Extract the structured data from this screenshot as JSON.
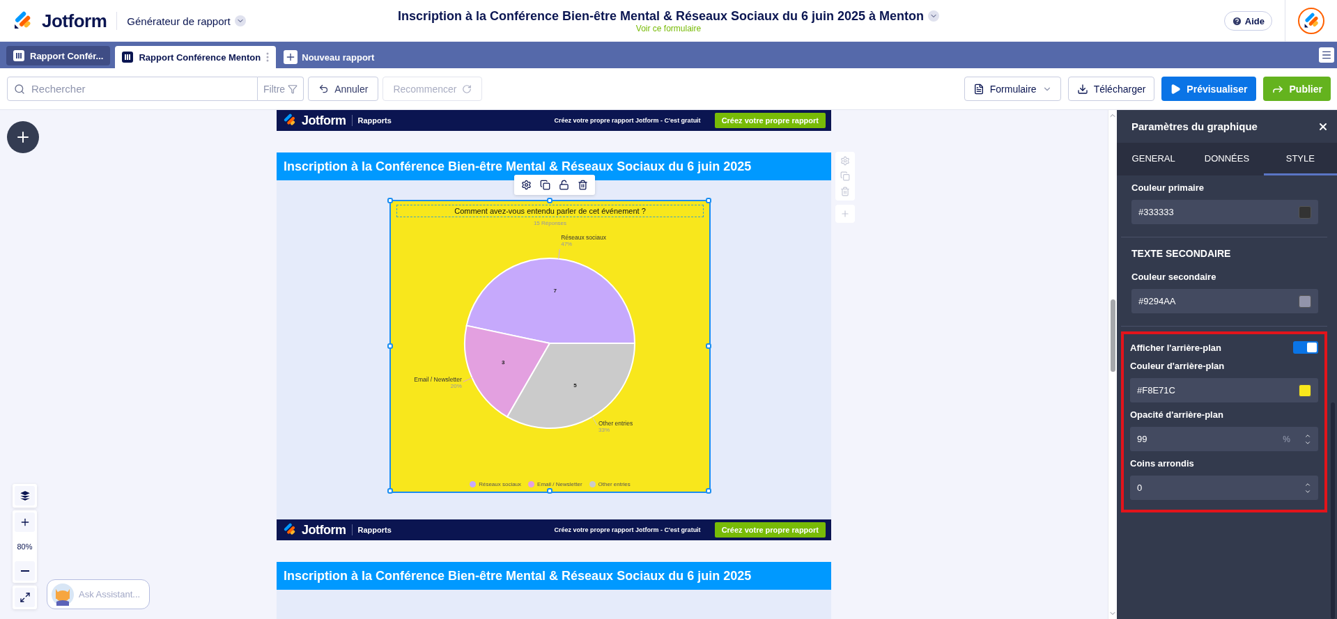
{
  "header": {
    "brand": "Jotform",
    "app_menu": "Générateur de rapport",
    "form_title": "Inscription à la Conférence Bien-être Mental & Réseaux Sociaux du 6 juin 2025 à Menton",
    "form_link": "Voir ce formulaire",
    "help": "Aide"
  },
  "tabs": [
    {
      "label": "Rapport Confér...",
      "selected": false
    },
    {
      "label": "Rapport Conférence Menton",
      "selected": true
    }
  ],
  "new_tab": "Nouveau rapport",
  "toolbar": {
    "search_placeholder": "Rechercher",
    "filter": "Filtre",
    "history": [
      {
        "label": "Annuler",
        "disabled": false
      },
      {
        "label": "Recommencer",
        "disabled": true
      }
    ],
    "actions": [
      {
        "label": "Formulaire",
        "kind": "dropdown"
      },
      {
        "label": "Télécharger",
        "kind": "download"
      },
      {
        "label": "Prévisualiser",
        "kind": "preview"
      },
      {
        "label": "Publier",
        "kind": "publish"
      }
    ]
  },
  "canvas": {
    "zoom": "80%",
    "assistant": "Ask Assistant...",
    "pages": [
      {
        "banner": {
          "brand": "Jotform",
          "section": "Rapports",
          "promo": "Créez votre propre rapport Jotform - C'est gratuit",
          "cta": "Créez votre propre rapport"
        },
        "title": "Inscription à la Conférence Bien-être Mental & Réseaux Sociaux du 6 juin 2025",
        "chart": {
          "selected": true,
          "subtitle": "15 Réponses",
          "percent_labels": [
            "47%",
            "20%",
            "33%"
          ],
          "chart_data": {
            "type": "pie",
            "title": "Comment avez-vous entendu parler de cet événement ?",
            "categories": [
              "Réseaux sociaux",
              "Email / Newsletter",
              "Other entries"
            ],
            "values": [
              7,
              3,
              5
            ],
            "data_labels": true
          },
          "legend": [
            {
              "label": "Réseaux sociaux",
              "color": "#c6a9fc"
            },
            {
              "label": "Email / Newsletter",
              "color": "#e3a0e0"
            },
            {
              "label": "Other entries",
              "color": "#cbcbcb"
            }
          ]
        }
      },
      {
        "banner": {
          "brand": "Jotform",
          "section": "Rapports",
          "promo": "Créez votre propre rapport Jotform - C'est gratuit",
          "cta": "Créez votre propre rapport"
        },
        "title": "Inscription à la Conférence Bien-être Mental & Réseaux Sociaux du 6 juin 2025"
      }
    ]
  },
  "settings": {
    "title": "Paramètres du graphique",
    "tabs": [
      {
        "label": "GENERAL",
        "selected": false
      },
      {
        "label": "DONNÉES",
        "selected": false
      },
      {
        "label": "STYLE",
        "selected": true
      }
    ],
    "groups": [
      {
        "highlighted": false,
        "items": [
          {
            "kind": "color",
            "label": "Couleur primaire",
            "value": "#333333",
            "color": "#333333"
          }
        ]
      },
      {
        "highlighted": false,
        "items": [
          {
            "kind": "heading",
            "label": "TEXTE SECONDAIRE"
          },
          {
            "kind": "color",
            "label": "Couleur secondaire",
            "value": "#9294AA",
            "color": "#9294aa"
          }
        ]
      },
      {
        "highlighted": true,
        "items": [
          {
            "kind": "toggle",
            "label": "Afficher l'arrière-plan",
            "on": true
          },
          {
            "kind": "color",
            "label": "Couleur d'arrière-plan",
            "value": "#F8E71C",
            "color": "#f8e71c"
          },
          {
            "kind": "number",
            "label": "Opacité d'arrière-plan",
            "value": "99",
            "unit": "%"
          },
          {
            "kind": "number",
            "label": "Coins arrondis",
            "value": "0"
          }
        ]
      }
    ]
  }
}
